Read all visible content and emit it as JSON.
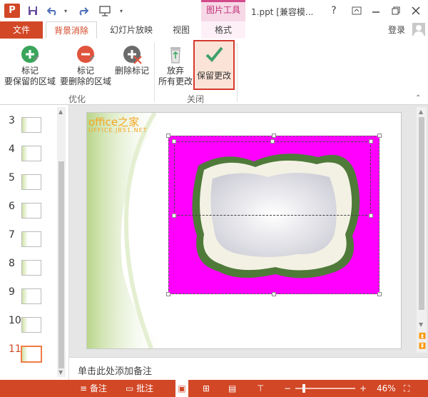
{
  "titlebar": {
    "app_icon": "P",
    "context_group": "图片工具",
    "doc_title": "1.ppt [兼容模...",
    "help": "?"
  },
  "tabs": {
    "file": "文件",
    "items": [
      "背景消除",
      "幻灯片放映",
      "视图",
      "格式"
    ],
    "login": "登录"
  },
  "ribbon": {
    "mark_keep_l1": "标记",
    "mark_keep_l2": "要保留的区域",
    "mark_remove_l1": "标记",
    "mark_remove_l2": "要删除的区域",
    "delete_mark": "删除标记",
    "discard_l1": "放弃",
    "discard_l2": "所有更改",
    "keep_changes": "保留更改",
    "group_optimize": "优化",
    "group_close": "关闭"
  },
  "slides": [
    "3",
    "4",
    "5",
    "6",
    "7",
    "8",
    "9",
    "10",
    "11"
  ],
  "slide_content": {
    "watermark": "office之家",
    "watermark_sub": "OFFICE.JB51.NET"
  },
  "notes_placeholder": "单击此处添加备注",
  "status": {
    "notes": "备注",
    "comments": "批注",
    "zoom": "46%"
  },
  "colors": {
    "accent": "#d24726",
    "context": "#d24a8a",
    "magenta": "#ff00ff",
    "highlight": "#d53a2d"
  }
}
